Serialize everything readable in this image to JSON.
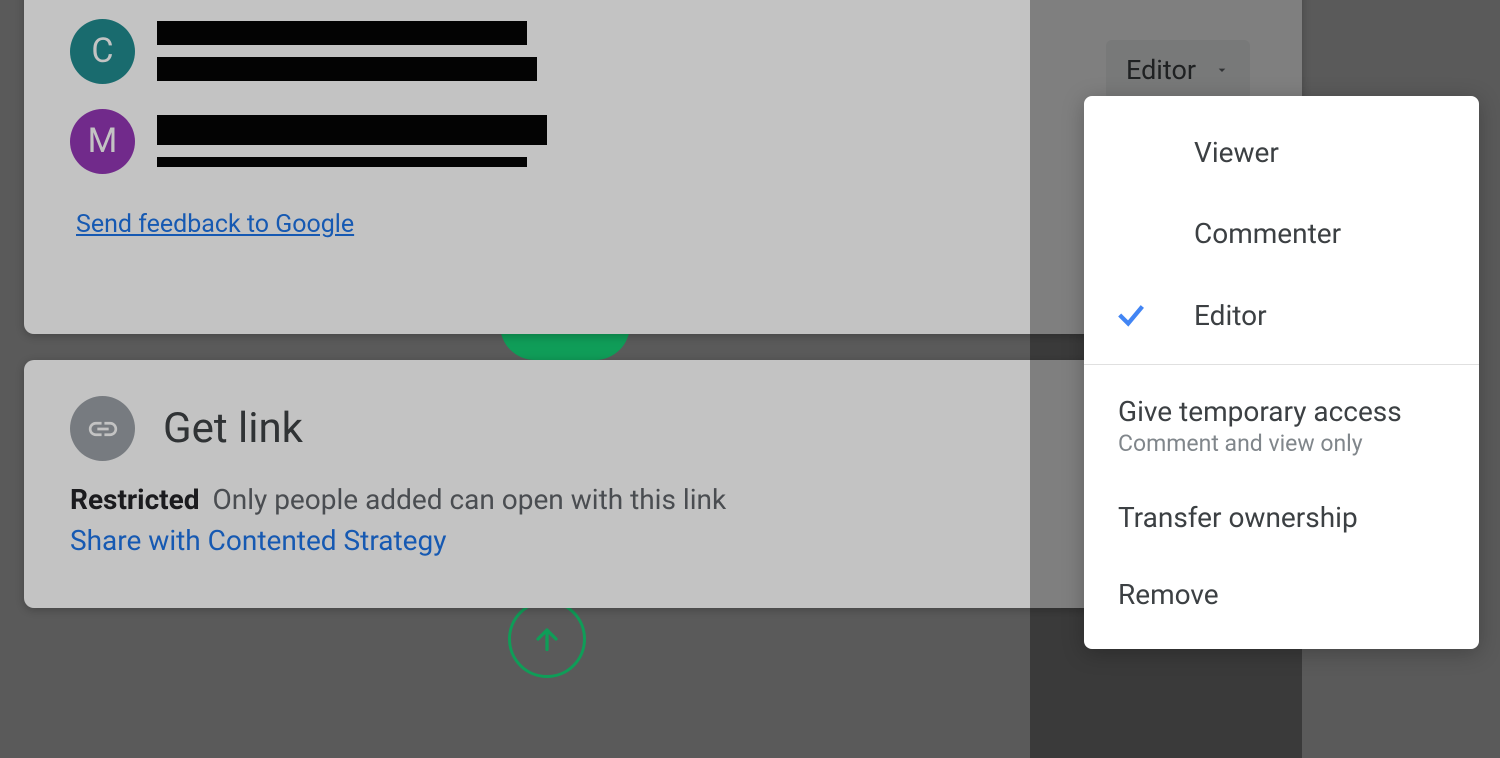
{
  "share": {
    "people": [
      {
        "initial": "C",
        "role": "Editor"
      },
      {
        "initial": "M"
      }
    ],
    "feedback_label": "Send feedback to Google"
  },
  "role_button_label": "Editor",
  "getlink": {
    "title": "Get link",
    "restricted_label": "Restricted",
    "restricted_desc": "Only people added can open with this link",
    "share_with_label": "Share with Contented Strategy"
  },
  "menu": {
    "viewer": "Viewer",
    "commenter": "Commenter",
    "editor": "Editor",
    "temp_access": "Give temporary access",
    "temp_sub": "Comment and view only",
    "transfer": "Transfer ownership",
    "remove": "Remove"
  }
}
